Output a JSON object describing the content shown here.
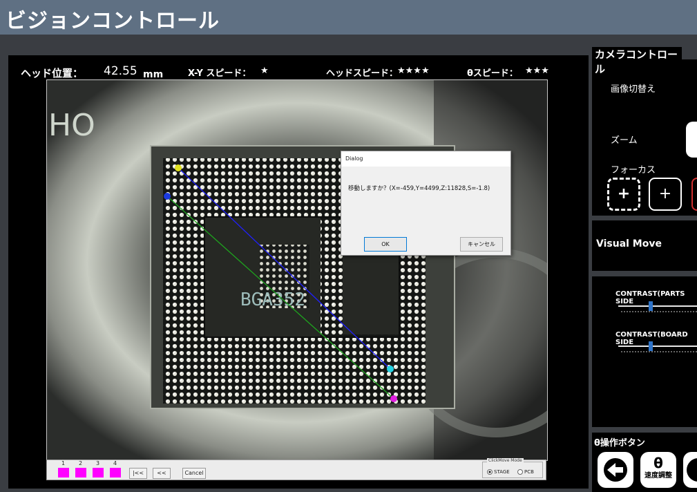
{
  "window": {
    "title": "ビジョンコントロール"
  },
  "header": {
    "head_pos_label": "ヘッド位置：",
    "head_pos_value": "42.55",
    "head_pos_unit": "mm",
    "xy_speed_label": "X-Y スピード：",
    "xy_speed_value": "★",
    "head_speed_label": "ヘッドスピード：",
    "head_speed_value": "★★★★",
    "theta_speed_label": "θスピード：",
    "theta_speed_value": "★★★"
  },
  "camera_view": {
    "chip_label": "BGA352",
    "watermark": "HO",
    "colors": {
      "line_blue": "#2020ff",
      "line_green": "#1ea51e",
      "pt_yellow": "#e0e020",
      "pt_blue": "#1a3adf",
      "pt_cyan": "#23d3e3",
      "pt_magenta": "#e020e0"
    }
  },
  "bottom_bar": {
    "markers": [
      "1",
      "2",
      "3",
      "4"
    ],
    "marker_color": "#ff00ff",
    "btn_first": "|<<",
    "btn_back": "<<",
    "btn_cancel": "Cancel",
    "mode_legend": "ClickMove Mode",
    "mode_options": [
      "STAGE",
      "PCB"
    ],
    "mode_selected": "STAGE"
  },
  "dialog": {
    "title": "Dialog",
    "message": "移動しますか？(X=-459,Y=4499,Z:11828,S=-1.8)",
    "ok": "OK",
    "cancel": "キャンセル"
  },
  "camera_control": {
    "title": "カメラコントロール",
    "image_switch": "画像切替え",
    "zoom": "ズーム",
    "focus": "フォーカス",
    "focus_btn_icon": "focus-plus-icon",
    "focus_plus_icon": "plus-icon"
  },
  "visual_move": {
    "title": "Visual Move"
  },
  "contrast": {
    "parts": "CONTRAST(PARTS SIDE",
    "board": "CONTRAST(BOARD SIDE",
    "parts_level": 0.42,
    "board_level": 0.42
  },
  "theta_ops": {
    "title": "θ操作ボタン",
    "speed_btn_symbol": "θ",
    "speed_btn_label": "速度調整",
    "back_icon": "arrow-left-circle-icon"
  }
}
